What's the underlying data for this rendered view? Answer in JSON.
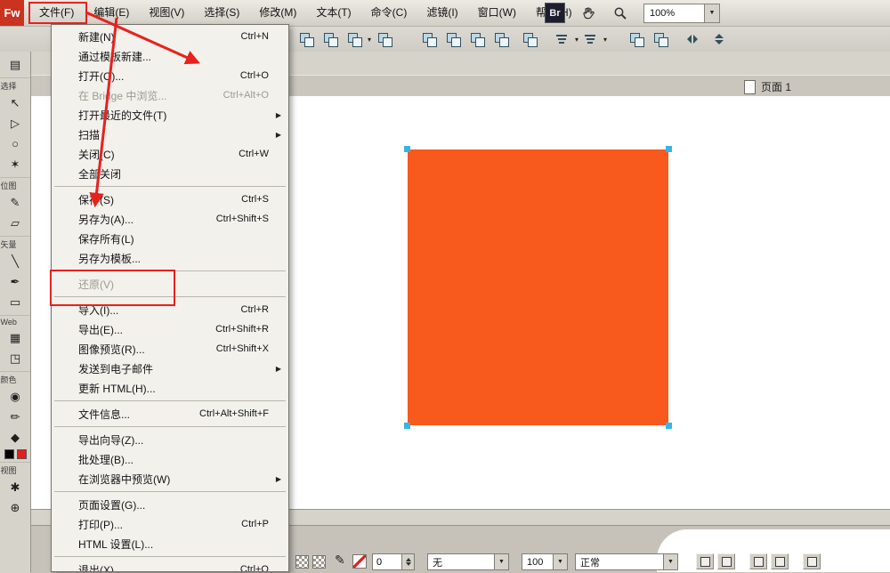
{
  "window": {
    "logo_text": "Fw",
    "menus": [
      "文件(F)",
      "编辑(E)",
      "视图(V)",
      "选择(S)",
      "修改(M)",
      "文本(T)",
      "命令(C)",
      "滤镜(I)",
      "窗口(W)",
      "帮助(H)"
    ],
    "br_label": "Br",
    "zoom_value": "100%"
  },
  "toolbar": {
    "icons": [
      {
        "name": "pages-panel-icon",
        "glyph": "stack",
        "gap": 3
      },
      {
        "name": "states-panel-icon",
        "glyph": "stack"
      },
      {
        "name": "library-panel-icon",
        "glyph": "stack",
        "dd": true
      },
      {
        "name": "import-symbol-icon",
        "glyph": "stack",
        "gap": 12
      },
      {
        "name": "group-button",
        "glyph": "stack",
        "gap": 28
      },
      {
        "name": "ungroup-button",
        "glyph": "stack"
      },
      {
        "name": "bring-to-front-button",
        "glyph": "stack"
      },
      {
        "name": "send-to-back-button",
        "glyph": "stack"
      },
      {
        "name": "bring-forward-button",
        "glyph": "stack",
        "gap": 10
      },
      {
        "name": "align-button",
        "glyph": "bars",
        "dd": true,
        "gap": 14
      },
      {
        "name": "distribute-button",
        "glyph": "bars",
        "dd": true,
        "gap": 10
      },
      {
        "name": "rotate-cw-button",
        "glyph": "stack",
        "gap": 30
      },
      {
        "name": "rotate-ccw-button",
        "glyph": "stack"
      },
      {
        "name": "flip-horizontal-button",
        "glyph": "fliph",
        "gap": 14
      },
      {
        "name": "flip-vertical-button",
        "glyph": "flipv",
        "gap": 8
      }
    ]
  },
  "left_toolbar": {
    "top_icon": {
      "name": "document-icon",
      "glyph": "▤"
    },
    "sections": [
      {
        "label": "选择",
        "tools": [
          {
            "name": "pointer-tool",
            "glyph": "↖"
          },
          {
            "name": "subselection-tool",
            "glyph": "▷"
          },
          {
            "name": "lasso-tool",
            "glyph": "○"
          },
          {
            "name": "magic-wand-tool",
            "glyph": "✶"
          }
        ]
      },
      {
        "label": "位图",
        "tools": [
          {
            "name": "brush-tool",
            "glyph": "✎"
          },
          {
            "name": "eraser-tool",
            "glyph": "▱"
          }
        ]
      },
      {
        "label": "矢量",
        "tools": [
          {
            "name": "line-tool",
            "glyph": "╲"
          },
          {
            "name": "pen-tool",
            "glyph": "✒"
          },
          {
            "name": "rectangle-tool",
            "glyph": "▭"
          }
        ]
      },
      {
        "label": "Web",
        "tools": [
          {
            "name": "slice-tool",
            "glyph": "▦"
          },
          {
            "name": "hotspot-tool",
            "glyph": "◳"
          }
        ]
      },
      {
        "label": "颜色",
        "tools": [
          {
            "name": "eyedropper-tool",
            "glyph": "◉"
          },
          {
            "name": "pencil-tool",
            "glyph": "✏"
          },
          {
            "name": "paint-bucket-tool",
            "glyph": "◆"
          }
        ],
        "swatches": [
          {
            "name": "stroke-color-swatch",
            "color": "#000000"
          },
          {
            "name": "fill-color-swatch",
            "color": "#e02020"
          }
        ]
      },
      {
        "label": "视图",
        "tools": [
          {
            "name": "hand-tool",
            "glyph": "✱"
          },
          {
            "name": "zoom-tool",
            "glyph": "⊕"
          }
        ]
      }
    ]
  },
  "file_menu": {
    "items": [
      {
        "label": "新建(N)",
        "shortcut": "Ctrl+N"
      },
      {
        "label": "通过模板新建..."
      },
      {
        "label": "打开(O)...",
        "shortcut": "Ctrl+O"
      },
      {
        "label": "在 Bridge 中浏览...",
        "shortcut": "Ctrl+Alt+O",
        "disabled": true
      },
      {
        "label": "打开最近的文件(T)",
        "submenu": true
      },
      {
        "label": "扫描",
        "submenu": true
      },
      {
        "label": "关闭(C)",
        "shortcut": "Ctrl+W"
      },
      {
        "label": "全部关闭"
      },
      {
        "separator": true
      },
      {
        "label": "保存(S)",
        "shortcut": "Ctrl+S"
      },
      {
        "label": "另存为(A)...",
        "shortcut": "Ctrl+Shift+S"
      },
      {
        "label": "保存所有(L)"
      },
      {
        "label": "另存为模板..."
      },
      {
        "separator": true
      },
      {
        "label": "还原(V)",
        "disabled": true
      },
      {
        "separator": true
      },
      {
        "label": "导入(I)...",
        "shortcut": "Ctrl+R"
      },
      {
        "label": "导出(E)...",
        "shortcut": "Ctrl+Shift+R"
      },
      {
        "label": "图像预览(R)...",
        "shortcut": "Ctrl+Shift+X"
      },
      {
        "label": "发送到电子邮件",
        "submenu": true
      },
      {
        "label": "更新 HTML(H)..."
      },
      {
        "separator": true
      },
      {
        "label": "文件信息...",
        "shortcut": "Ctrl+Alt+Shift+F"
      },
      {
        "separator": true
      },
      {
        "label": "导出向导(Z)..."
      },
      {
        "label": "批处理(B)..."
      },
      {
        "label": "在浏览器中预览(W)",
        "submenu": true
      },
      {
        "separator": true
      },
      {
        "label": "页面设置(G)..."
      },
      {
        "label": "打印(P)...",
        "shortcut": "Ctrl+P"
      },
      {
        "label": "HTML 设置(L)..."
      },
      {
        "separator": true
      },
      {
        "label": "退出(X)",
        "shortcut": "Ctrl+Q"
      }
    ]
  },
  "document": {
    "page_tab_label": "页面 1",
    "object_color": "#f8591c",
    "handle_color": "#35b5e8"
  },
  "properties_bar": {
    "pencil_icon": "✎",
    "stroke_size_value": "0",
    "stroke_category_value": "无",
    "opacity_value": "100",
    "blend_mode_value": "正常"
  },
  "annotations": {
    "color": "#e8211d"
  }
}
